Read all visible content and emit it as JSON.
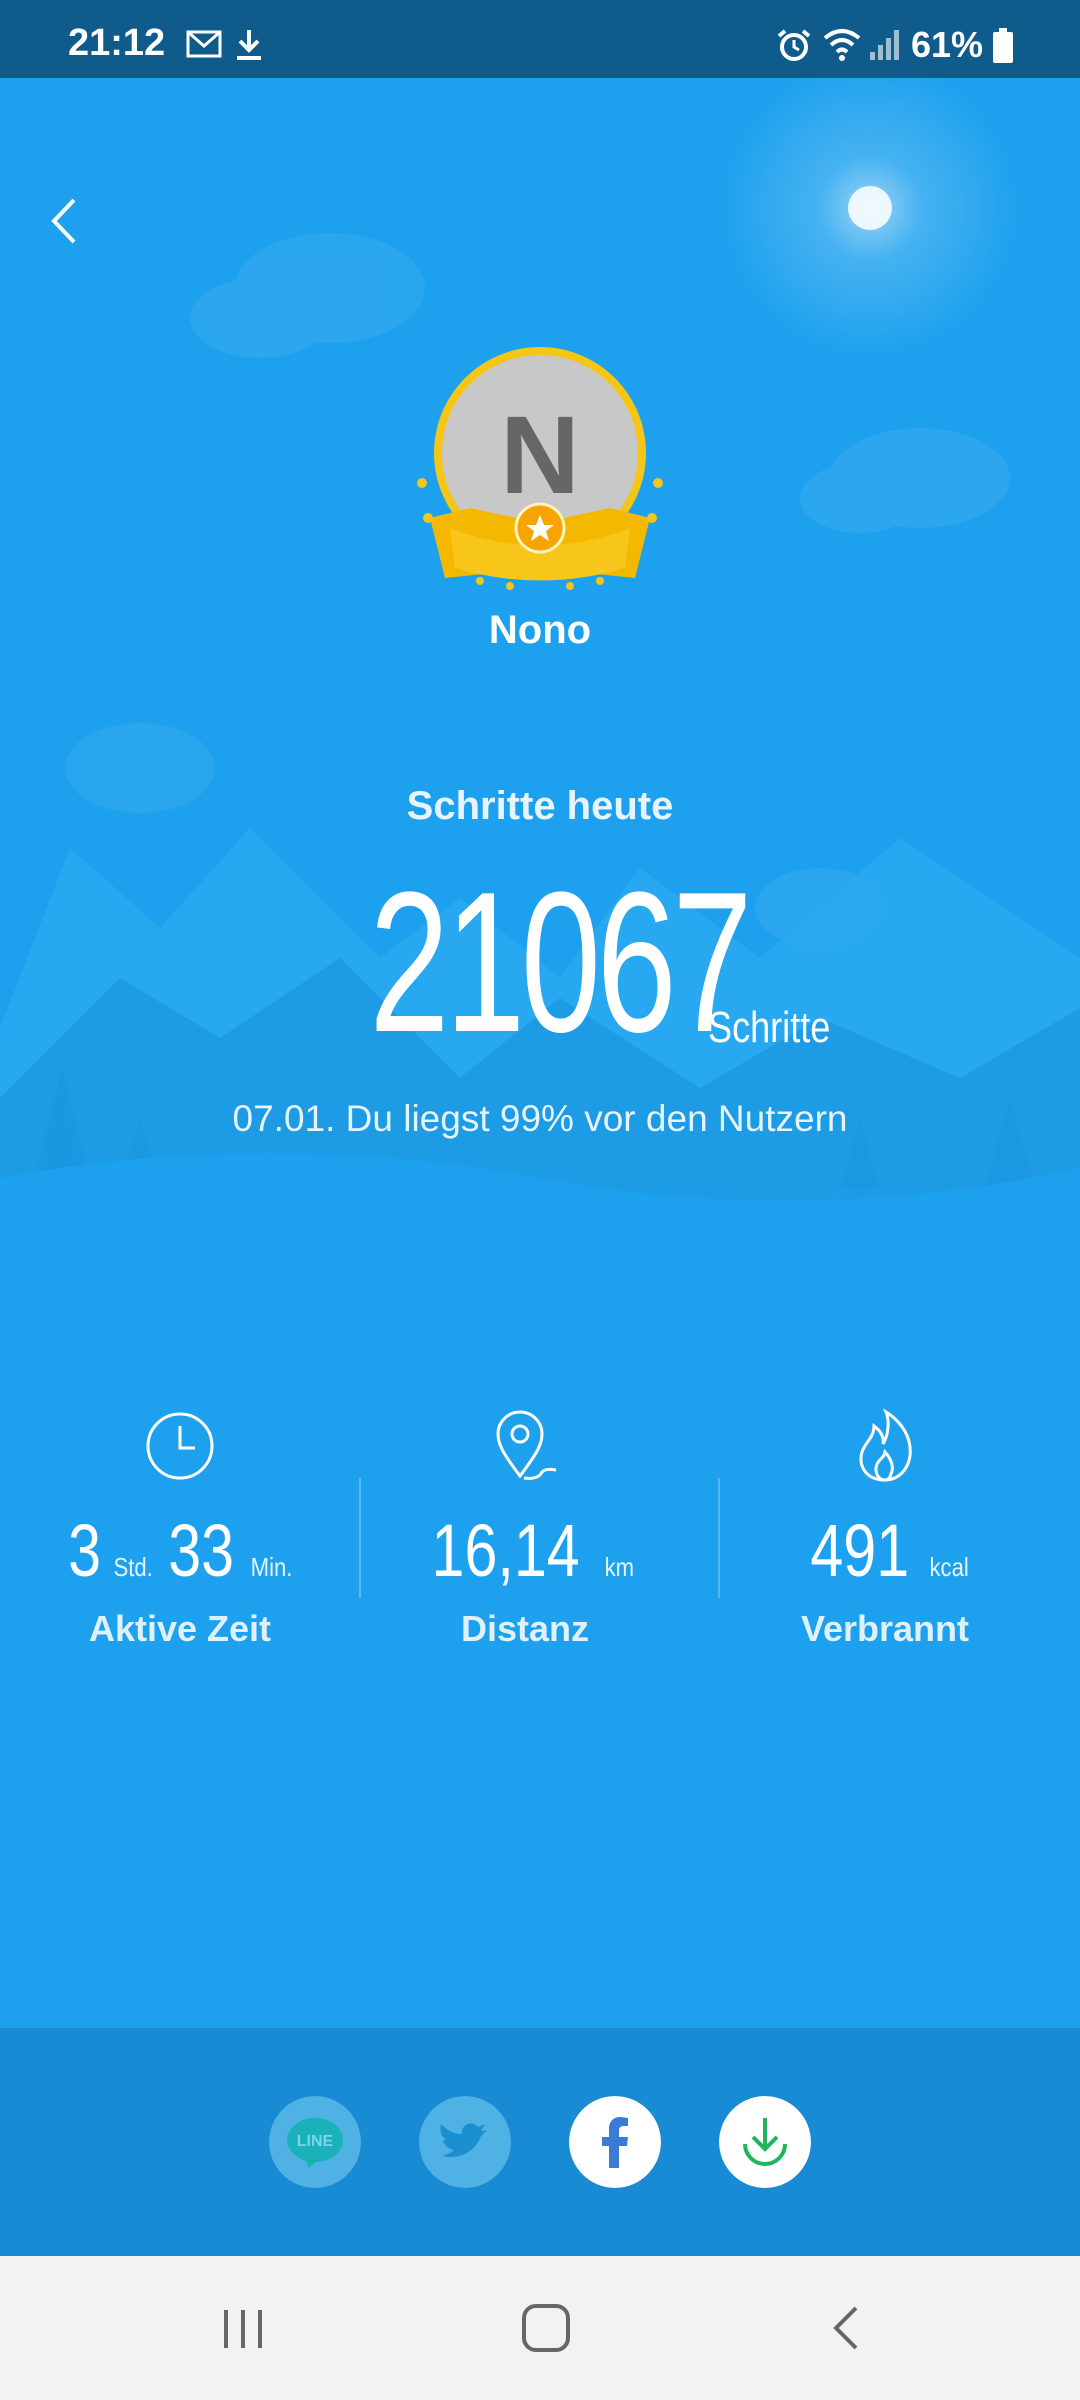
{
  "status_bar": {
    "time": "21:12",
    "battery": "61%",
    "icons": [
      "mail-icon",
      "download-icon",
      "alarm-icon",
      "wifi-icon",
      "signal-icon",
      "battery-icon"
    ]
  },
  "profile": {
    "initial": "N",
    "name": "Nono"
  },
  "steps": {
    "caption": "Schritte heute",
    "value": "21067",
    "unit": "Schritte",
    "rank_text": "07.01. Du liegst 99% vor den Nutzern"
  },
  "stats": {
    "active_time": {
      "hours": "3",
      "hours_unit": "Std.",
      "minutes": "33",
      "minutes_unit": "Min.",
      "label": "Aktive Zeit",
      "icon": "clock-icon"
    },
    "distance": {
      "value": "16,14",
      "unit": "km",
      "label": "Distanz",
      "icon": "location-pin-icon"
    },
    "burned": {
      "value": "491",
      "unit": "kcal",
      "label": "Verbrannt",
      "icon": "flame-icon"
    }
  },
  "share": {
    "line_label": "LINE",
    "buttons": [
      "line-icon",
      "twitter-icon",
      "facebook-icon",
      "save-download-icon"
    ]
  },
  "colors": {
    "background": "#1da1ee",
    "status_bar": "#0f5c8c",
    "share_bar": "#198bd4",
    "medal": "#f5c518"
  }
}
